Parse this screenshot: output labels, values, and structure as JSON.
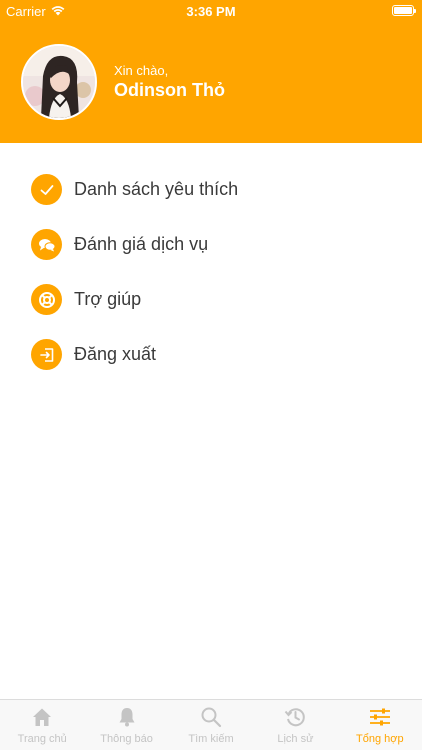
{
  "status_bar": {
    "carrier": "Carrier",
    "time": "3:36 PM"
  },
  "profile": {
    "greeting": "Xin chào,",
    "name": "Odinson Thỏ"
  },
  "menu": {
    "items": [
      {
        "label": "Danh sách yêu thích",
        "icon": "check-icon"
      },
      {
        "label": "Đánh giá dịch vụ",
        "icon": "chat-icon"
      },
      {
        "label": "Trợ giúp",
        "icon": "lifebuoy-icon"
      },
      {
        "label": "Đăng xuất",
        "icon": "logout-icon"
      }
    ]
  },
  "tabbar": {
    "tabs": [
      {
        "label": "Trang chủ",
        "icon": "home-icon"
      },
      {
        "label": "Thông báo",
        "icon": "bell-icon"
      },
      {
        "label": "Tìm kiếm",
        "icon": "search-icon"
      },
      {
        "label": "Lịch sử",
        "icon": "history-icon"
      },
      {
        "label": "Tổng hợp",
        "icon": "sliders-icon"
      }
    ],
    "active_index": 4
  },
  "colors": {
    "accent": "#FFA500",
    "tab_inactive": "#c4c4c4",
    "menu_text": "#3a3a3a"
  }
}
